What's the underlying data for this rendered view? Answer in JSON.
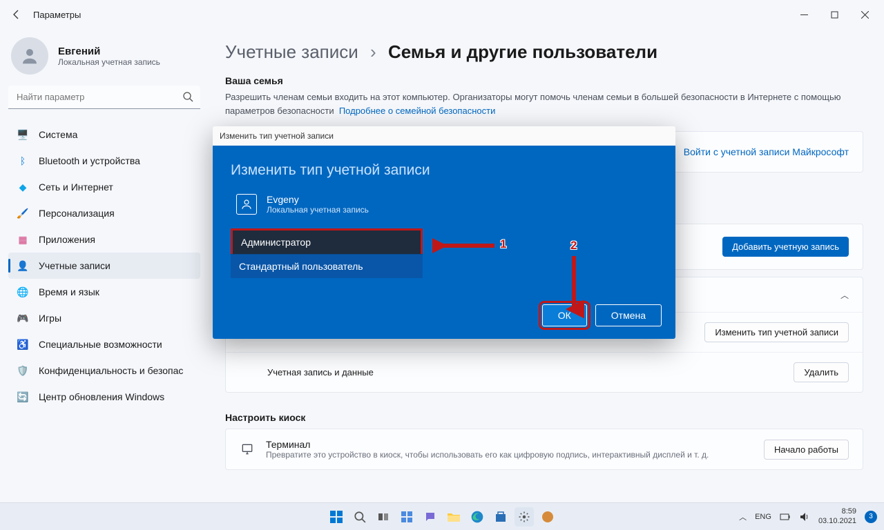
{
  "window": {
    "title": "Параметры"
  },
  "user": {
    "name": "Евгений",
    "subtitle": "Локальная учетная запись"
  },
  "search": {
    "placeholder": "Найти параметр"
  },
  "nav": [
    {
      "icon": "🖥️",
      "label": "Система",
      "color": "#0078d4"
    },
    {
      "icon": "ᛒ",
      "label": "Bluetooth и устройства",
      "color": "#0078d4"
    },
    {
      "icon": "◆",
      "label": "Сеть и Интернет",
      "color": "#0ea5e9"
    },
    {
      "icon": "🖌️",
      "label": "Персонализация",
      "color": "#ef6c35"
    },
    {
      "icon": "▦",
      "label": "Приложения",
      "color": "#d13b7b"
    },
    {
      "icon": "👤",
      "label": "Учетные записи",
      "color": "#5aa457"
    },
    {
      "icon": "🌐",
      "label": "Время и язык",
      "color": "#3573c5"
    },
    {
      "icon": "🎮",
      "label": "Игры",
      "color": "#777"
    },
    {
      "icon": "♿",
      "label": "Специальные возможности",
      "color": "#4b8ce0"
    },
    {
      "icon": "🛡️",
      "label": "Конфиденциальность и безопас",
      "color": "#777"
    },
    {
      "icon": "🔄",
      "label": "Центр обновления Windows",
      "color": "#0078d4"
    }
  ],
  "activeNav": 5,
  "breadcrumb": {
    "parent": "Учетные записи",
    "current": "Семья и другие пользователи"
  },
  "family": {
    "heading": "Ваша семья",
    "desc": "Разрешить членам семьи входить на этот компьютер. Организаторы могут помочь членам семьи в большей безопасности в Интернете с помощью параметров безопасности",
    "link": "Подробнее о семейной безопасности",
    "signin": "Войти с учетной записи Майкрософт"
  },
  "otherUsers": {
    "addBtn": "Добавить учетную запись",
    "changeType": "Изменить тип учетной записи",
    "accountData": "Учетная запись и данные",
    "deleteBtn": "Удалить"
  },
  "kiosk": {
    "heading": "Настроить киоск",
    "title": "Терминал",
    "desc": "Превратите это устройство в киоск, чтобы использовать его как цифровую подпись, интерактивный дисплей и т. д.",
    "btn": "Начало работы"
  },
  "dialog": {
    "titlebar": "Изменить тип учетной записи",
    "heading": "Изменить тип учетной записи",
    "user": {
      "name": "Evgeny",
      "sub": "Локальная учетная запись"
    },
    "options": {
      "admin": "Администратор",
      "standard": "Стандартный пользователь"
    },
    "ok": "ОК",
    "cancel": "Отмена"
  },
  "annotations": {
    "one": "1",
    "two": "2"
  },
  "tray": {
    "lang": "ENG",
    "time": "8:59",
    "date": "03.10.2021",
    "notif": "3"
  }
}
